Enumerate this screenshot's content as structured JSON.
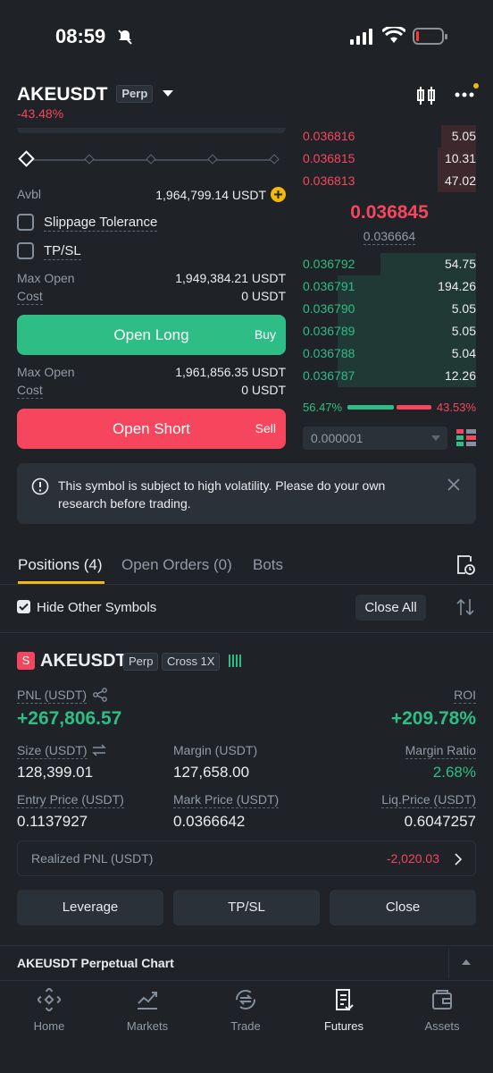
{
  "status": {
    "time": "08:59"
  },
  "header": {
    "symbol": "AKEUSDT",
    "tag": "Perp",
    "change": "-43.48%"
  },
  "order_form": {
    "avbl_label": "Avbl",
    "avbl_value": "1,964,799.14 USDT",
    "slippage_label": "Slippage Tolerance",
    "tpsl_label": "TP/SL",
    "long": {
      "max_open_label": "Max Open",
      "max_open_value": "1,949,384.21 USDT",
      "cost_label": "Cost",
      "cost_value": "0 USDT",
      "button": "Open Long",
      "side": "Buy"
    },
    "short": {
      "max_open_label": "Max Open",
      "max_open_value": "1,961,856.35 USDT",
      "cost_label": "Cost",
      "cost_value": "0 USDT",
      "button": "Open Short",
      "side": "Sell"
    }
  },
  "orderbook": {
    "asks": [
      {
        "price": "0.036816",
        "qty": "5.05",
        "depth": 0.2
      },
      {
        "price": "0.036815",
        "qty": "10.31",
        "depth": 0.22
      },
      {
        "price": "0.036813",
        "qty": "47.02",
        "depth": 0.22
      }
    ],
    "last_price": "0.036845",
    "mark_price": "0.036664",
    "bids": [
      {
        "price": "0.036792",
        "qty": "54.75",
        "depth": 0.55
      },
      {
        "price": "0.036791",
        "qty": "194.26",
        "depth": 0.8
      },
      {
        "price": "0.036790",
        "qty": "5.05",
        "depth": 0.8
      },
      {
        "price": "0.036789",
        "qty": "5.05",
        "depth": 0.8
      },
      {
        "price": "0.036788",
        "qty": "5.04",
        "depth": 0.8
      },
      {
        "price": "0.036787",
        "qty": "12.26",
        "depth": 0.8
      }
    ],
    "buy_ratio": "56.47%",
    "sell_ratio": "43.53%",
    "buy_fraction": 0.5647,
    "tick": "0.000001"
  },
  "banner": {
    "text": "This symbol is subject to high volatility. Please do your own research before trading."
  },
  "tabs": [
    {
      "label": "Positions (4)"
    },
    {
      "label": "Open Orders (0)"
    },
    {
      "label": "Bots"
    }
  ],
  "filter": {
    "hide_label": "Hide Other Symbols",
    "close_all": "Close All"
  },
  "position": {
    "badge": "S",
    "symbol": "AKEUSDT",
    "tag1": "Perp",
    "tag2": "Cross 1X",
    "pnl_label": "PNL (USDT)",
    "pnl_value": "+267,806.57",
    "roi_label": "ROI",
    "roi_value": "+209.78%",
    "size_label": "Size (USDT)",
    "size_value": "128,399.01",
    "margin_label": "Margin (USDT)",
    "margin_value": "127,658.00",
    "ratio_label": "Margin Ratio",
    "ratio_value": "2.68%",
    "entry_label": "Entry Price (USDT)",
    "entry_value": "0.1137927",
    "mark_label": "Mark Price (USDT)",
    "mark_value": "0.0366642",
    "liq_label": "Liq.Price (USDT)",
    "liq_value": "0.6047257",
    "realized_label": "Realized PNL (USDT)",
    "realized_value": "-2,020.03",
    "buttons": [
      "Leverage",
      "TP/SL",
      "Close"
    ]
  },
  "chart_bar": {
    "label": "AKEUSDT Perpetual Chart"
  },
  "nav": [
    {
      "label": "Home",
      "icon": "binance-icon"
    },
    {
      "label": "Markets",
      "icon": "chart-icon"
    },
    {
      "label": "Trade",
      "icon": "swap-icon"
    },
    {
      "label": "Futures",
      "icon": "futures-icon"
    },
    {
      "label": "Assets",
      "icon": "wallet-icon"
    }
  ],
  "colors": {
    "green": "#2ebd85",
    "red": "#f6465d",
    "accent": "#f0b90b",
    "bg": "#1f2327"
  }
}
